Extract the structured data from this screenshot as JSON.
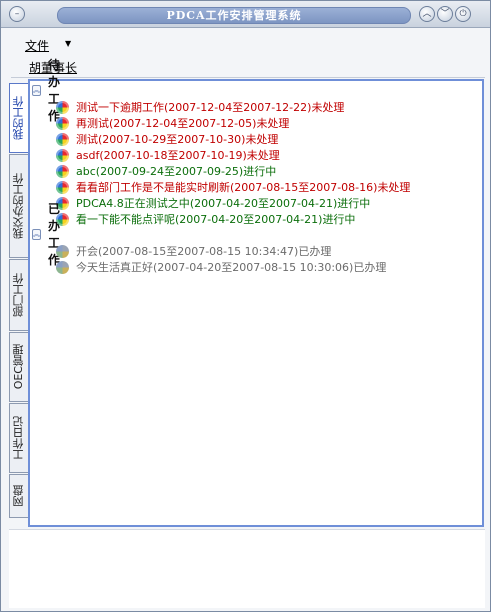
{
  "window": {
    "title": "PDCA工作安排管理系统",
    "buttons": [
      "minimize",
      "restore",
      "close"
    ]
  },
  "menu": {
    "file_label": "文件"
  },
  "user": {
    "name": "胡董事长"
  },
  "tabs": [
    {
      "label": "我的工作",
      "active": true
    },
    {
      "label": "我交办的工作",
      "active": false
    },
    {
      "label": "部门工作",
      "active": false
    },
    {
      "label": "OEC管理",
      "active": false
    },
    {
      "label": "工作日记",
      "active": false
    },
    {
      "label": "网盘",
      "active": false
    }
  ],
  "groups": {
    "pending": {
      "title": "待办工作",
      "items": [
        {
          "name": "测试一下逾期工作",
          "range": "(2007-12-04至2007-12-22)",
          "status": "未处理",
          "color": "#c00000"
        },
        {
          "name": "再测试",
          "range": "(2007-12-04至2007-12-05)",
          "status": "未处理",
          "color": "#c00000"
        },
        {
          "name": "测试",
          "range": "(2007-10-29至2007-10-30)",
          "status": "未处理",
          "color": "#c00000"
        },
        {
          "name": "asdf",
          "range": "(2007-10-18至2007-10-19)",
          "status": "未处理",
          "color": "#c00000"
        },
        {
          "name": "abc",
          "range": "(2007-09-24至2007-09-25)",
          "status": "进行中",
          "color": "#0b6e0b"
        },
        {
          "name": "看看部门工作是不是能实时刷新",
          "range": "(2007-08-15至2007-08-16)",
          "status": "未处理",
          "color": "#c00000"
        },
        {
          "name": "PDCA4.8正在测试之中",
          "range": "(2007-04-20至2007-04-21)",
          "status": "进行中",
          "color": "#0b6e0b"
        },
        {
          "name": "看一下能不能点评呢",
          "range": "(2007-04-20至2007-04-21)",
          "status": "进行中",
          "color": "#0b6e0b"
        }
      ]
    },
    "done": {
      "title": "已办工作",
      "items": [
        {
          "name": "开会",
          "range": "(2007-08-15至2007-08-15 10:34:47)",
          "status": "已办理",
          "color": "#6b6b6b"
        },
        {
          "name": "今天生活真正好",
          "range": "(2007-04-20至2007-08-15 10:30:06)",
          "status": "已办理",
          "color": "#6b6b6b"
        }
      ]
    }
  }
}
